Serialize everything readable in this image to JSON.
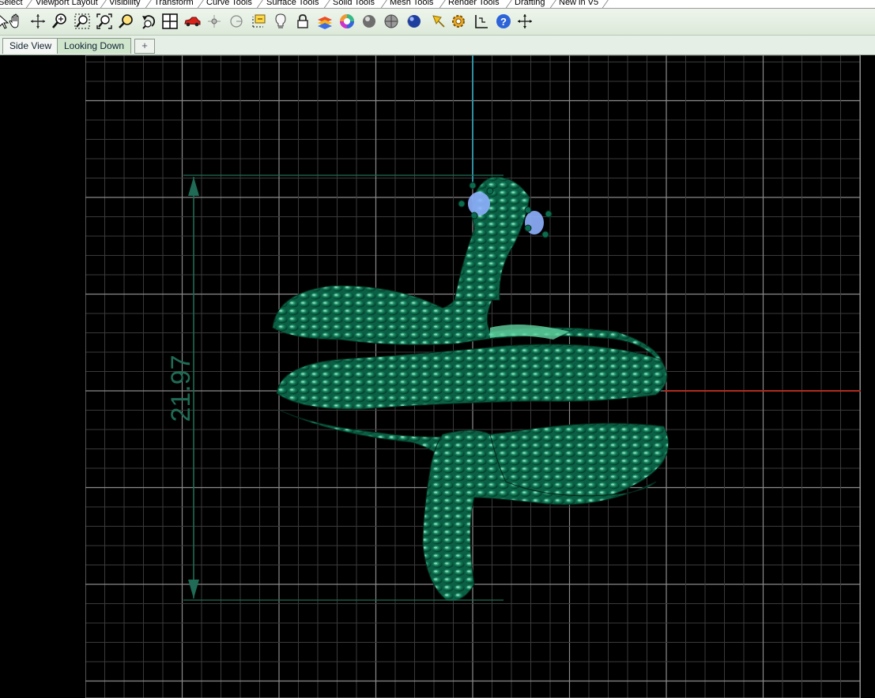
{
  "menu_tabs": [
    "Select",
    "Viewport Layout",
    "Visibility",
    "Transform",
    "Curve Tools",
    "Surface Tools",
    "Solid Tools",
    "Mesh Tools",
    "Render Tools",
    "Drafting",
    "New in V5"
  ],
  "toolbar_icons": [
    "select-icon",
    "pan-hand-icon",
    "rotate-view-icon",
    "zoom-icon",
    "zoom-window-icon",
    "zoom-extents-icon",
    "zoom-selected-icon",
    "undo-view-icon",
    "four-viewports-icon",
    "car-icon",
    "object-snap-icon",
    "osnap-circle-icon",
    "gumball-icon",
    "light-bulb-icon",
    "lock-icon",
    "layer-icon",
    "color-wheel-icon",
    "shaded-sphere-icon",
    "rendered-sphere-icon",
    "ghosted-sphere-icon",
    "blue-sphere-icon",
    "flashlight-icon",
    "settings-gear-icon",
    "dimension-icon",
    "help-icon",
    "expand-icon"
  ],
  "view_tabs": [
    {
      "label": "Side View",
      "active": false
    },
    {
      "label": "Looking Down",
      "active": true
    }
  ],
  "add_tab_symbol": "+",
  "dimension": {
    "value": "21.97"
  },
  "colors": {
    "grid_minor": "#3a3a3a",
    "grid_major": "#8a8a8a",
    "x_axis": "#b22a1e",
    "y_axis": "#2f8fa0",
    "model": "#0b6b4f",
    "dimension": "#1f6b55",
    "selection": "#8fb1ff"
  }
}
